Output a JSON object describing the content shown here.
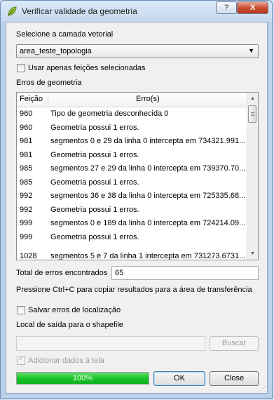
{
  "window": {
    "title": "Verificar validade da geometria",
    "help_label": "?",
    "close_label": "X"
  },
  "layer": {
    "label": "Selecione a camada vetorial",
    "value": "area_teste_topologia"
  },
  "selected_only": {
    "label": "Usar apenas feições selecionadas",
    "checked": false
  },
  "errors": {
    "label": "Erros de geometria",
    "columns": [
      "Feição",
      "Erro(s)"
    ],
    "rows": [
      [
        "960",
        "Tipo de geometria desconhecida 0"
      ],
      [
        "960",
        "Geometria possui 1 erros."
      ],
      [
        "981",
        "segmentos 0 e 29 da linha 0 intercepta em 734321.991..."
      ],
      [
        "981",
        "Geometria possui 1 erros."
      ],
      [
        "985",
        "segmentos 27 e 29 da linha 0 intercepta em 739370.70..."
      ],
      [
        "985",
        "Geometria possui 1 erros."
      ],
      [
        "992",
        "segmentos 36 e 38 da linha 0 intercepta em 725335.68..."
      ],
      [
        "992",
        "Geometria possui 1 erros."
      ],
      [
        "999",
        "segmentos 0 e 189 da linha 0 intercepta em 724214.09..."
      ],
      [
        "999",
        "Geometria possui 1 erros."
      ],
      [
        "1028",
        "segmentos 5 e 7 da linha 1 intercepta em 731273.6731..."
      ]
    ]
  },
  "total": {
    "label": "Total de erros encontrados",
    "value": "65"
  },
  "hint": "Pressione Ctrl+C para copiar resultados para a área de transferência",
  "save_errors": {
    "label": "Salvar erros de localização",
    "checked": false
  },
  "output": {
    "label": "Local de saída para o shapefile",
    "value": "",
    "browse_label": "Buscar"
  },
  "add_to_canvas": {
    "label": "Adicionar dados à tela",
    "checked": true
  },
  "progress": {
    "value": 1.0,
    "text": "100%"
  },
  "buttons": {
    "ok": "OK",
    "close": "Close"
  }
}
